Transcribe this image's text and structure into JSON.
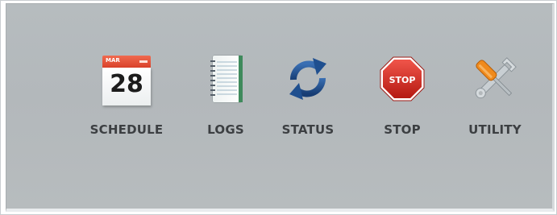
{
  "toolbar": {
    "items": [
      {
        "id": "schedule",
        "label": "SCHEDULE",
        "icon": "calendar-icon",
        "calendar_day": "28",
        "calendar_month": "MAR"
      },
      {
        "id": "logs",
        "label": "LOGS",
        "icon": "notebook-icon"
      },
      {
        "id": "status",
        "label": "STATUS",
        "icon": "refresh-icon"
      },
      {
        "id": "stop",
        "label": "STOP",
        "icon": "stop-sign-icon",
        "sign_text": "STOP"
      },
      {
        "id": "utility",
        "label": "UTILITY",
        "icon": "tools-icon"
      }
    ]
  },
  "colors": {
    "panel_background": "#b5babd",
    "label_text": "#3c3f42",
    "calendar_header": "#e0533a",
    "refresh_arrows": "#1f4f8f",
    "stop_sign": "#d92a22",
    "screwdriver_handle": "#f08a1c"
  }
}
